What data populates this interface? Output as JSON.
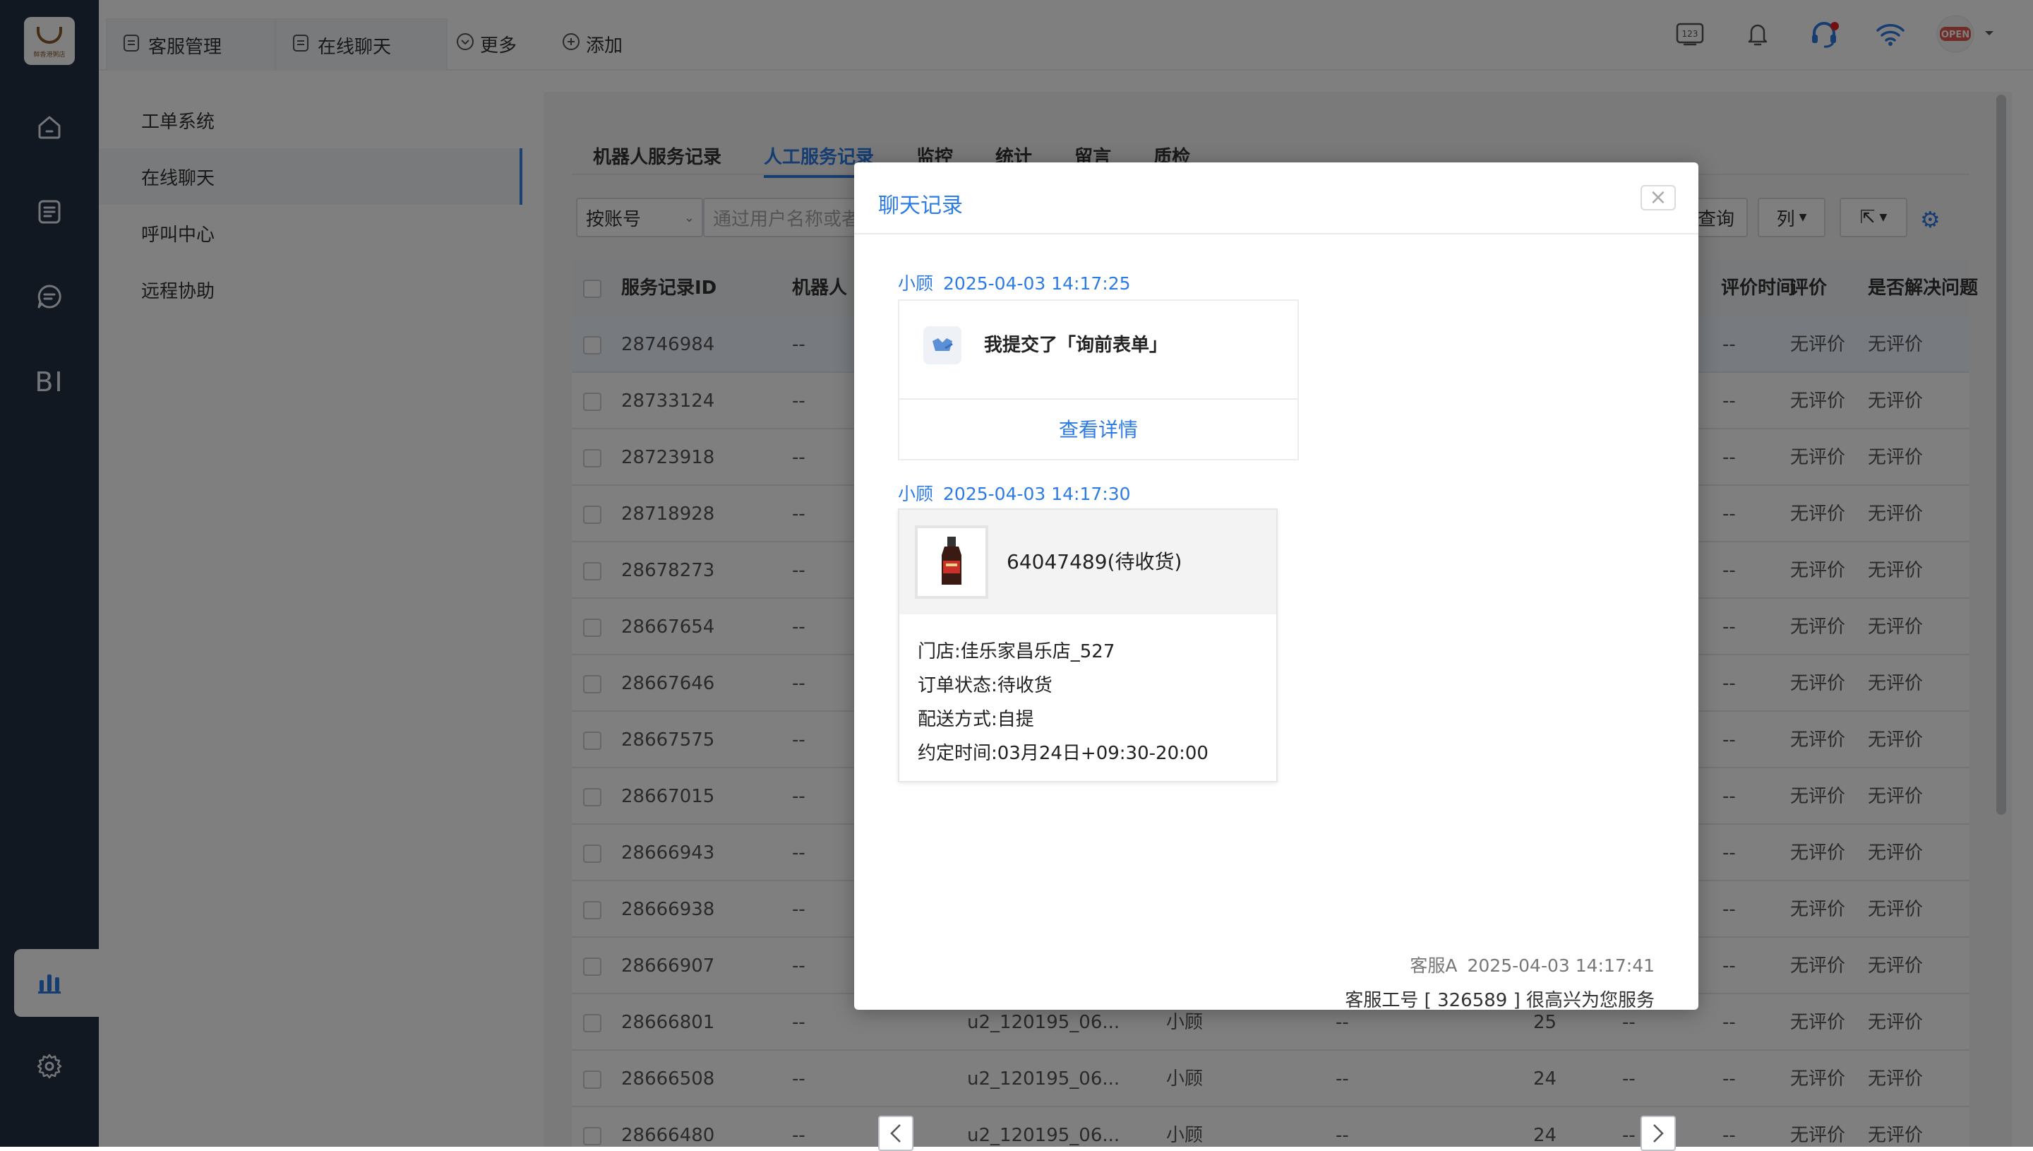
{
  "logo": {
    "text": "鲜香港粥店"
  },
  "sidebar": {
    "items": [
      {
        "icon": "home-icon"
      },
      {
        "icon": "document-icon"
      },
      {
        "icon": "chat-icon"
      },
      {
        "label": "BI"
      },
      {
        "icon": "bar-chart-icon"
      },
      {
        "icon": "gear-icon"
      }
    ]
  },
  "topbar": {
    "tabs": [
      {
        "label": "客服管理"
      },
      {
        "label": "在线聊天"
      },
      {
        "label": "更多"
      },
      {
        "label": "添加"
      }
    ],
    "badge_keyboard": "123",
    "status_badge": "OPEN"
  },
  "subnav": {
    "items": [
      {
        "label": "工单系统"
      },
      {
        "label": "在线聊天"
      },
      {
        "label": "呼叫中心"
      },
      {
        "label": "远程协助"
      }
    ]
  },
  "main": {
    "tabs": [
      {
        "label": "机器人服务记录"
      },
      {
        "label": "人工服务记录"
      },
      {
        "label": "监控"
      },
      {
        "label": "统计"
      },
      {
        "label": "留言"
      },
      {
        "label": "质检"
      }
    ],
    "filter": {
      "select": "按账号",
      "search_placeholder": "通过用户名称或者",
      "query_button": "查询",
      "columns_button": "列"
    },
    "table": {
      "headers": [
        "服务记录ID",
        "机器人",
        "评价时间",
        "评价",
        "是否解决问题"
      ],
      "rows": [
        {
          "id": "28746984",
          "robot": "--",
          "eval_time": "--",
          "rating": "无评价",
          "resolved": "无评价"
        },
        {
          "id": "28733124",
          "robot": "--",
          "eval_time": "--",
          "rating": "无评价",
          "resolved": "无评价"
        },
        {
          "id": "28723918",
          "robot": "--",
          "eval_time": "--",
          "rating": "无评价",
          "resolved": "无评价"
        },
        {
          "id": "28718928",
          "robot": "--",
          "eval_time": "--",
          "rating": "无评价",
          "resolved": "无评价"
        },
        {
          "id": "28678273",
          "robot": "--",
          "eval_time": "--",
          "rating": "无评价",
          "resolved": "无评价"
        },
        {
          "id": "28667654",
          "robot": "--",
          "eval_time": "--",
          "rating": "无评价",
          "resolved": "无评价"
        },
        {
          "id": "28667646",
          "robot": "--",
          "eval_time": "--",
          "rating": "无评价",
          "resolved": "无评价"
        },
        {
          "id": "28667575",
          "robot": "--",
          "eval_time": "--",
          "rating": "无评价",
          "resolved": "无评价"
        },
        {
          "id": "28667015",
          "robot": "--",
          "eval_time": "--",
          "rating": "无评价",
          "resolved": "无评价"
        },
        {
          "id": "28666943",
          "robot": "--",
          "eval_time": "--",
          "rating": "无评价",
          "resolved": "无评价"
        },
        {
          "id": "28666938",
          "robot": "--",
          "eval_time": "--",
          "rating": "无评价",
          "resolved": "无评价"
        },
        {
          "id": "28666907",
          "robot": "--",
          "eval_time": "--",
          "rating": "无评价",
          "resolved": "无评价"
        },
        {
          "id": "28666801",
          "robot": "--",
          "user": "u2_120195_06...",
          "agent": "小顾",
          "c5": "--",
          "count": "25",
          "c7": "--",
          "eval_time": "--",
          "rating": "无评价",
          "resolved": "无评价"
        },
        {
          "id": "28666508",
          "robot": "--",
          "user": "u2_120195_06...",
          "agent": "小顾",
          "c5": "--",
          "count": "24",
          "c7": "--",
          "eval_time": "--",
          "rating": "无评价",
          "resolved": "无评价"
        },
        {
          "id": "28666480",
          "robot": "--",
          "user": "u2_120195_06...",
          "agent": "小顾",
          "c5": "--",
          "count": "24",
          "c7": "--",
          "eval_time": "--",
          "rating": "无评价",
          "resolved": "无评价"
        }
      ]
    }
  },
  "modal": {
    "title": "聊天记录",
    "close": "×",
    "messages": [
      {
        "sender": "小顾",
        "time": "2025-04-03 14:17:25",
        "text": "我提交了「询前表单」",
        "link": "查看详情"
      },
      {
        "sender": "小顾",
        "time": "2025-04-03 14:17:30",
        "order": "64047489(待收货)",
        "lines": [
          "门店:佳乐家昌乐店_527",
          "订单状态:待收货",
          "配送方式:自提",
          "约定时间:03月24日+09:30-20:00"
        ]
      },
      {
        "sender": "客服A",
        "time": "2025-04-03 14:17:41",
        "text": "客服工号 [ 326589 ] 很高兴为您服务"
      }
    ]
  },
  "colors": {
    "accent": "#2d7be5",
    "sidebar": "#243042",
    "notify": "#e02020"
  }
}
